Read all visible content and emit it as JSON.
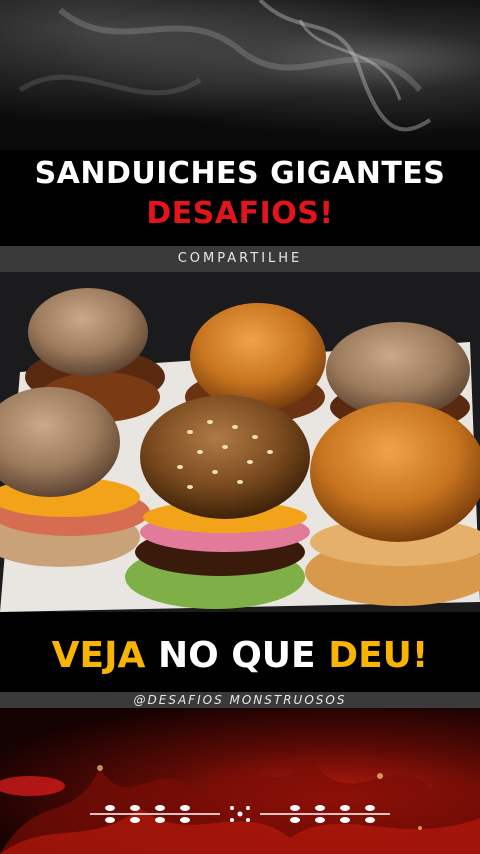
{
  "header": {
    "title_line1": "SANDUICHES GIGANTES",
    "title_line2": "DESAFIOS!"
  },
  "share_bar": {
    "label": "COMPARTILHE"
  },
  "cta": {
    "word1": "VEJA",
    "word2": "NO QUE",
    "word3": "DEU!"
  },
  "handle": {
    "label": "@DESAFIOS MONSTRUOSOS"
  },
  "colors": {
    "title_white": "#ffffff",
    "title_red": "#e3151a",
    "cta_yellow": "#f7b500",
    "bar_gray": "#3a3a3a"
  },
  "icons": {
    "divider": "laurel-divider-icon"
  }
}
